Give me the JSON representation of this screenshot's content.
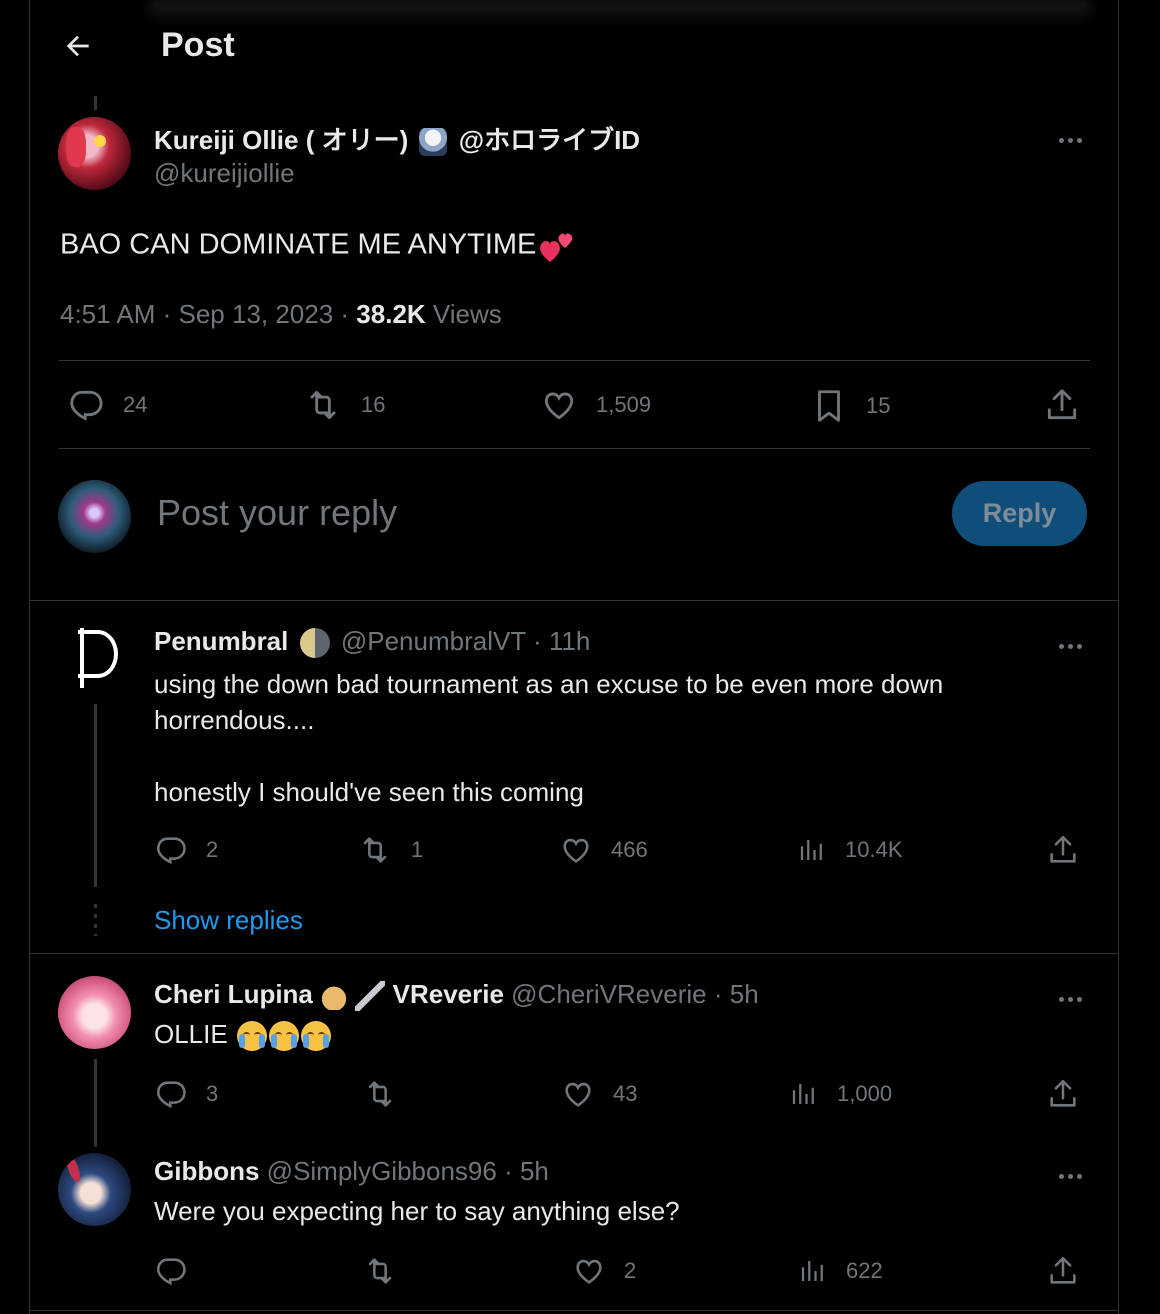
{
  "header": {
    "title": "Post"
  },
  "main_post": {
    "name": "Kureiji Ollie ( オリー)",
    "affiliation": "@ホロライブID",
    "handle": "@kureijiollie",
    "text": "BAO CAN DOMINATE ME ANYTIME",
    "timestamp": "4:51 AM · Sep 13, 2023 · ",
    "views_count": "38.2K",
    "views_label": " Views",
    "replies": "24",
    "reposts": "16",
    "likes": "1,509",
    "bookmarks": "15"
  },
  "reply_box": {
    "placeholder": "Post your reply",
    "button": "Reply"
  },
  "replies": [
    {
      "name": "Penumbral",
      "handle": "@PenumbralVT",
      "time": " · 11h",
      "text_line1": "using the down bad tournament as an excuse to be even more down",
      "text_line2": "horrendous....",
      "text_line3": "honestly I should've seen this coming",
      "replies": "2",
      "reposts": "1",
      "likes": "466",
      "views": "10.4K",
      "show_replies": "Show replies"
    },
    {
      "name": "Cheri Lupina",
      "name_suffix": "VReverie",
      "handle": "@CheriVReverie",
      "time": " · 5h",
      "text": "OLLIE",
      "replies": "3",
      "reposts": "",
      "likes": "43",
      "views": "1,000"
    },
    {
      "name": "Gibbons",
      "handle": "@SimplyGibbons96",
      "time": " · 5h",
      "text": "Were you expecting her to say anything else?",
      "replies": "",
      "reposts": "",
      "likes": "2",
      "views": "622"
    }
  ],
  "colors": {
    "background": "#000000",
    "text": "#e7e9ea",
    "muted": "#71767b",
    "accent": "#1d9bf0",
    "reply_button": "#0f4e78",
    "divider": "#2f3336"
  }
}
